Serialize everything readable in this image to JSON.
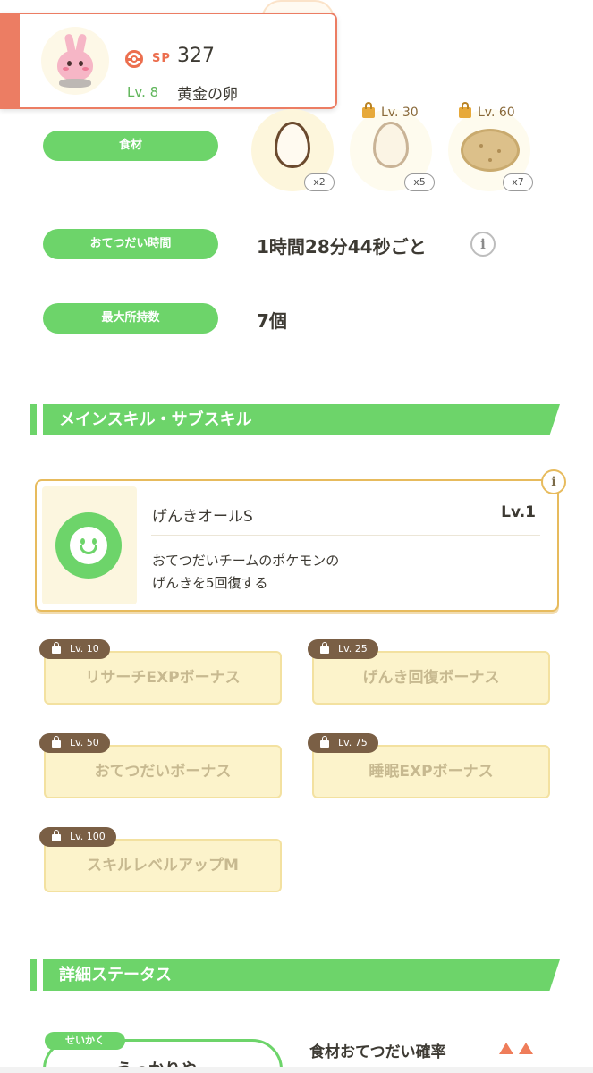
{
  "header": {
    "sp_label": "SP",
    "sp_value": "327",
    "level": "Lv. 8",
    "name": "黄金の卵"
  },
  "rows": {
    "ingredients_label": "食材",
    "ingredients": [
      {
        "count": "x2",
        "lock_level": "",
        "icon": "egg-icon"
      },
      {
        "count": "x5",
        "lock_level": "Lv. 30",
        "icon": "egg-icon"
      },
      {
        "count": "x7",
        "lock_level": "Lv. 60",
        "icon": "potato-icon"
      }
    ],
    "help_time_label": "おてつだい時間",
    "help_time_value": "1時間28分44秒ごと",
    "max_carry_label": "最大所持数",
    "max_carry_value": "7個"
  },
  "sections": {
    "skills_title": "メインスキル・サブスキル",
    "details_title": "詳細ステータス"
  },
  "main_skill": {
    "name": "げんきオールS",
    "level": "Lv.1",
    "desc_line1": "おてつだいチームのポケモンの",
    "desc_line2": "げんきを5回復する"
  },
  "sub_skills": [
    {
      "lock_level": "Lv. 10",
      "name": "リサーチEXPボーナス"
    },
    {
      "lock_level": "Lv. 25",
      "name": "げんき回復ボーナス"
    },
    {
      "lock_level": "Lv. 50",
      "name": "おてつだいボーナス"
    },
    {
      "lock_level": "Lv. 75",
      "name": "睡眠EXPボーナス"
    },
    {
      "lock_level": "Lv. 100",
      "name": "スキルレベルアップM"
    }
  ],
  "details": {
    "nature_tag": "せいかく",
    "nature_value": "うっかりや",
    "stat_label": "食材おてつだい確率"
  },
  "colors": {
    "accent_green": "#6dd46a",
    "accent_coral": "#ec7d63",
    "gold": "#e7bb5d"
  }
}
